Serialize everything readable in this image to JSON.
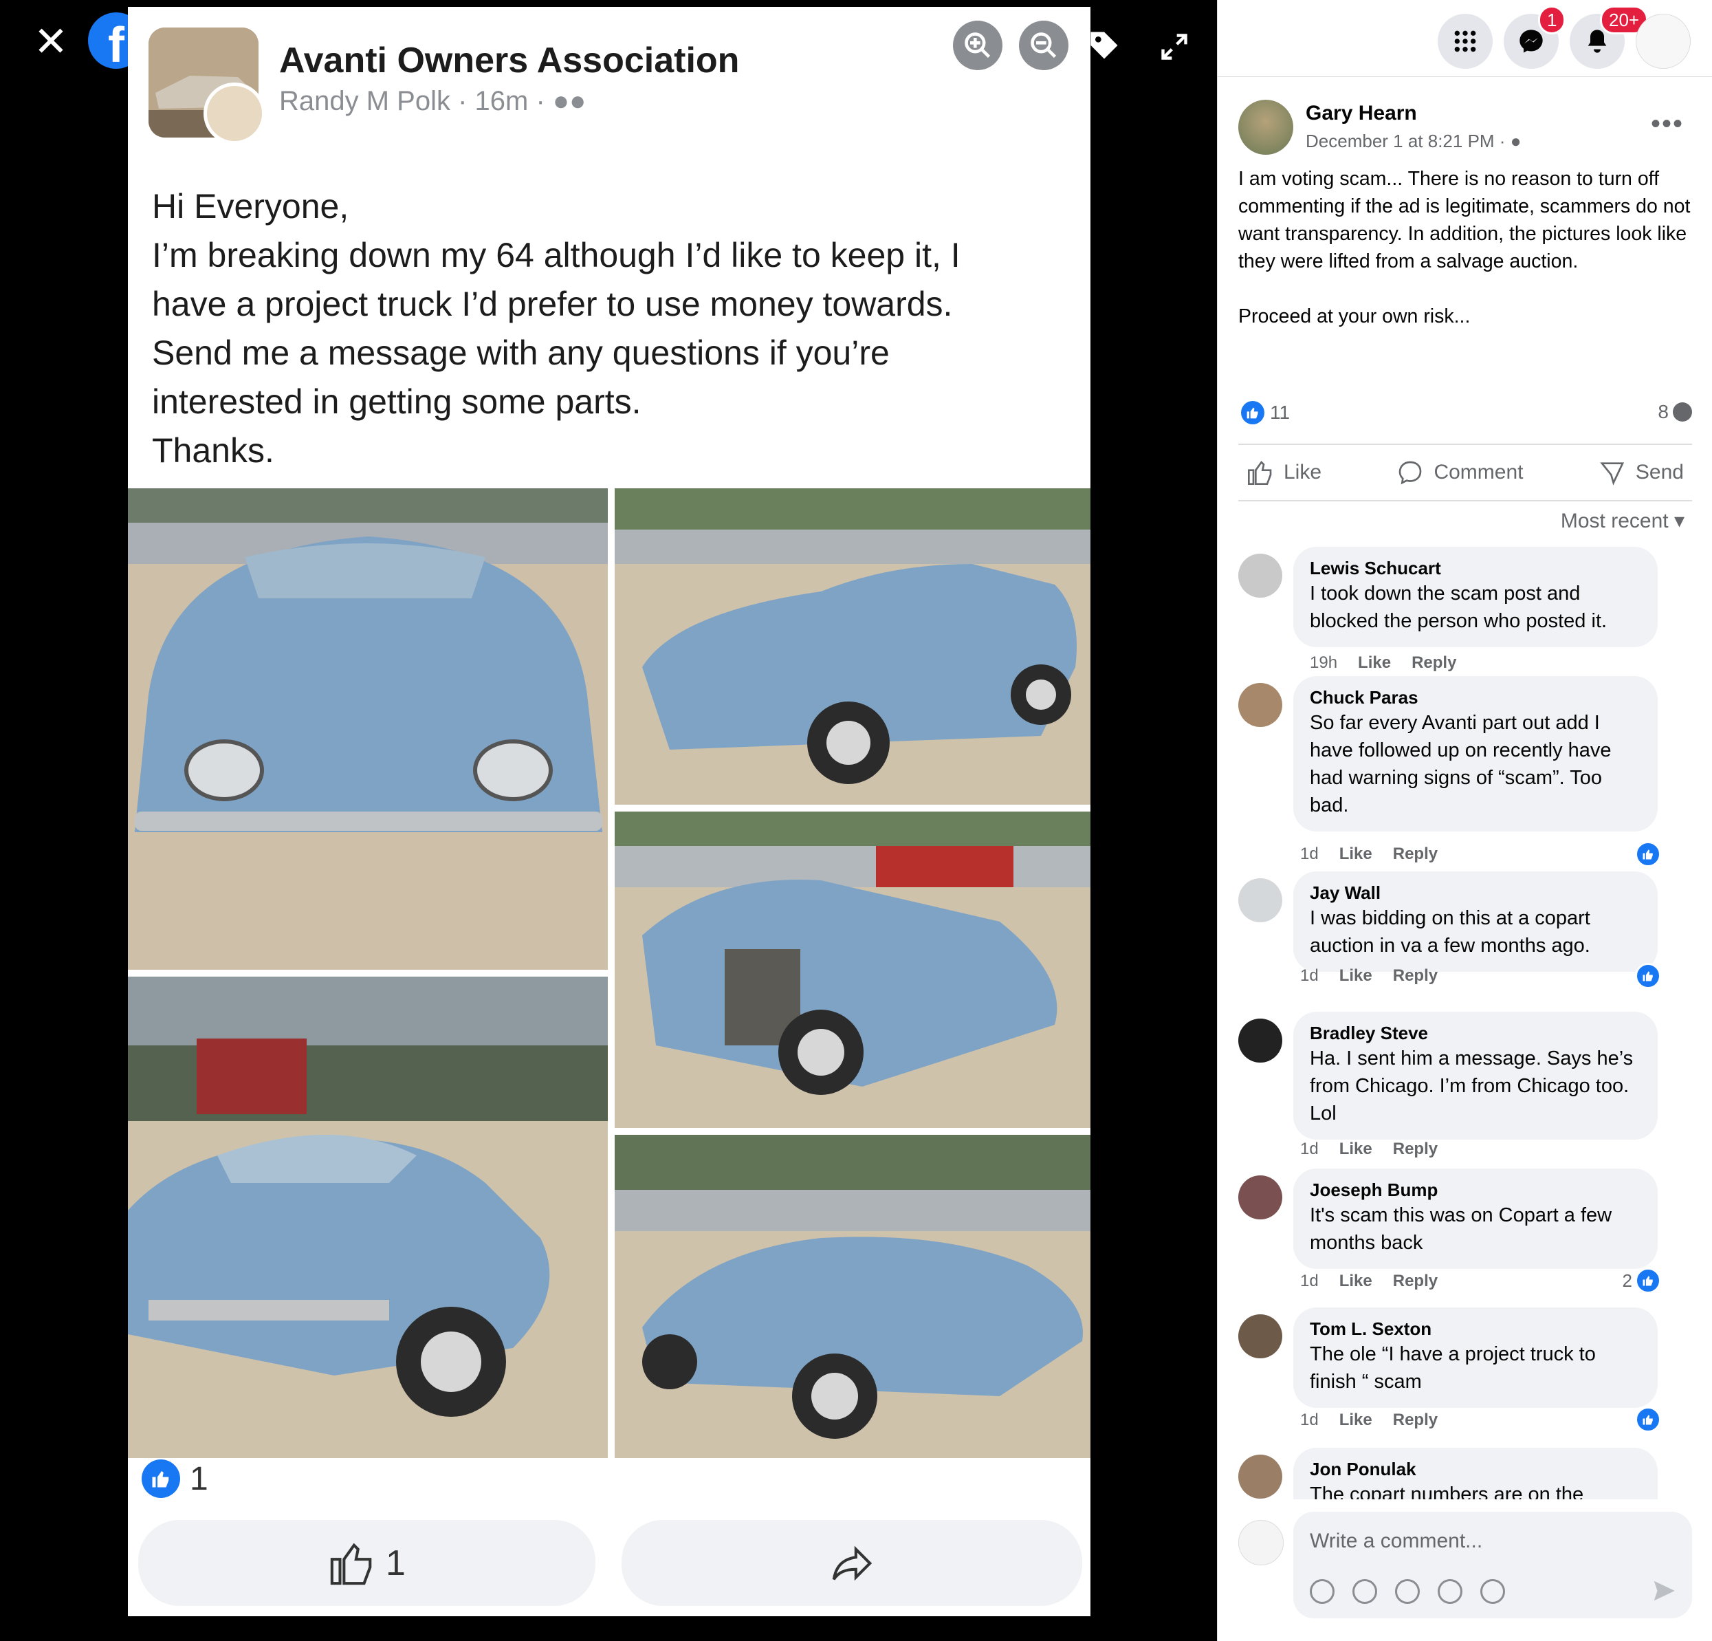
{
  "viewer": {
    "close_icon": "close-icon",
    "logo": "facebook-logo",
    "zoom_in_icon": "zoom-in-icon",
    "zoom_out_icon": "zoom-out-icon",
    "tag_icon": "tag-icon",
    "fullscreen_icon": "fullscreen-icon"
  },
  "screenshot": {
    "group_title": "Avanti Owners Association",
    "author": "Randy M Polk",
    "time": "16m",
    "body_lines": [
      "Hi Everyone,",
      "I’m breaking down my 64 although I’d like to keep it, I",
      "have a project truck I’d prefer to use money towards.",
      "Send me a message with any questions if you’re",
      "interested in getting some parts.",
      "Thanks."
    ],
    "reaction_count": "1",
    "like_count": "1"
  },
  "topbar": {
    "messenger_badge": "1",
    "notifications_badge": "20+"
  },
  "post": {
    "author": "Gary Hearn",
    "date": "December 1 at 8:21 PM ·",
    "text_p1": "I am voting scam... There is no reason to turn off commenting if the ad is legitimate, scammers do not want transparency. In addition, the pictures look like they were lifted from a salvage auction.",
    "text_p2": "Proceed at your own risk...",
    "likes": "11",
    "comments": "8",
    "like_label": "Like",
    "comment_label": "Comment",
    "send_label": "Send",
    "sort_label": "Most recent"
  },
  "comments": [
    {
      "name": "Lewis Schucart",
      "text": "I took down the scam post and blocked the person who posted it.",
      "age": "19h",
      "like": "Like",
      "reply": "Reply",
      "reactions": ""
    },
    {
      "name": "Chuck Paras",
      "text": "So far every Avanti part out add I have followed up on recently have had warning signs of “scam”. Too bad.",
      "age": "1d",
      "like": "Like",
      "reply": "Reply",
      "reactions": ""
    },
    {
      "name": "Jay Wall",
      "text": "I was bidding on this at a copart auction in va a few months ago.",
      "age": "1d",
      "like": "Like",
      "reply": "Reply",
      "reactions": ""
    },
    {
      "name": "Bradley Steve",
      "text": "Ha. I sent him a message. Says he’s from Chicago. I’m from Chicago too. Lol",
      "age": "1d",
      "like": "Like",
      "reply": "Reply",
      "reactions": ""
    },
    {
      "name": "Joeseph Bump",
      "text": "It's scam this was on Copart a few months back",
      "age": "1d",
      "like": "Like",
      "reply": "Reply",
      "reactions": "2"
    },
    {
      "name": "Tom L. Sexton",
      "text": "The ole “I have a project truck to finish “ scam",
      "age": "1d",
      "like": "Like",
      "reply": "Reply",
      "reactions": ""
    },
    {
      "name": "Jon Ponulak",
      "text": "The copart numbers are on the",
      "age": "",
      "like": "",
      "reply": "",
      "reactions": ""
    }
  ],
  "composer": {
    "placeholder": "Write a comment..."
  },
  "colors": {
    "facebook_blue": "#1877f2",
    "car_blue": "#7fa3c4",
    "badge_red": "#e41e3f"
  }
}
